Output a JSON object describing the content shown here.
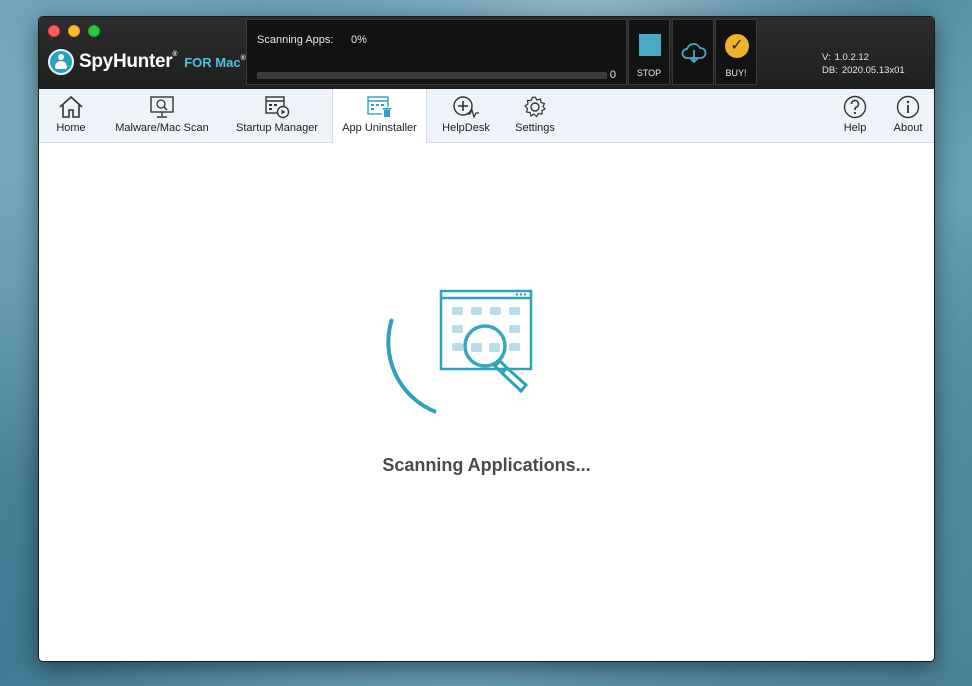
{
  "app": {
    "name": "SpyHunter",
    "trademark": "®",
    "suffix": "FOR Mac",
    "suffix_trademark": "®"
  },
  "scan": {
    "label": "Scanning Apps:",
    "percent": "0%",
    "progress": 0,
    "count": "0"
  },
  "controls": {
    "stop_label": "STOP",
    "buy_label": "BUY!"
  },
  "version": {
    "v_label": "V:",
    "v_value": "1.0.2.12",
    "db_label": "DB:",
    "db_value": "2020.05.13x01"
  },
  "toolbar": {
    "items": [
      {
        "label": "Home",
        "icon": "home-icon"
      },
      {
        "label": "Malware/Mac Scan",
        "icon": "monitor-scan-icon"
      },
      {
        "label": "Startup Manager",
        "icon": "startup-manager-icon"
      },
      {
        "label": "App Uninstaller",
        "icon": "app-uninstaller-icon",
        "active": true
      },
      {
        "label": "HelpDesk",
        "icon": "helpdesk-icon"
      },
      {
        "label": "Settings",
        "icon": "gear-icon"
      }
    ],
    "help_label": "Help",
    "about_label": "About"
  },
  "main": {
    "status": "Scanning Applications..."
  },
  "colors": {
    "accent": "#2ba3bd",
    "titlebar": "#1f1f1f",
    "toolbar_bg": "#eef3fa",
    "buy": "#f0b12c"
  }
}
